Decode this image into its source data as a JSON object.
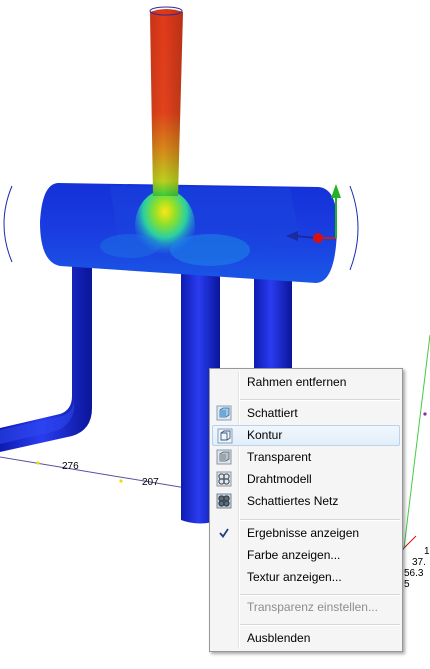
{
  "dimensions": {
    "d276": "276",
    "d207": "207",
    "r1": "1",
    "r2": "37.",
    "r3": "56.3",
    "r4": "5"
  },
  "menu": {
    "items": [
      {
        "label": "Rahmen entfernen",
        "icon": "none",
        "state": "normal"
      },
      {
        "label": "Schattiert",
        "icon": "shaded-cube-icon",
        "state": "normal"
      },
      {
        "label": "Kontur",
        "icon": "outline-cube-icon",
        "state": "hover"
      },
      {
        "label": "Transparent",
        "icon": "transparent-cube-icon",
        "state": "normal"
      },
      {
        "label": "Drahtmodell",
        "icon": "wireframe-mesh-icon",
        "state": "normal"
      },
      {
        "label": "Schattiertes Netz",
        "icon": "shaded-mesh-icon",
        "state": "normal"
      },
      {
        "label": "Ergebnisse anzeigen",
        "icon": "checkmark-icon",
        "state": "checked"
      },
      {
        "label": "Farbe anzeigen...",
        "icon": "none",
        "state": "normal"
      },
      {
        "label": "Textur anzeigen...",
        "icon": "none",
        "state": "normal"
      },
      {
        "label": "Transparenz einstellen...",
        "icon": "none",
        "state": "disabled"
      },
      {
        "label": "Ausblenden",
        "icon": "none",
        "state": "normal"
      }
    ]
  },
  "colors": {
    "result_blue": "#1a2fd6",
    "result_red": "#e0341a",
    "result_green": "#3ccd36",
    "axis_green": "#22b322",
    "axis_red": "#d81010",
    "axis_blue": "#1020a0"
  }
}
